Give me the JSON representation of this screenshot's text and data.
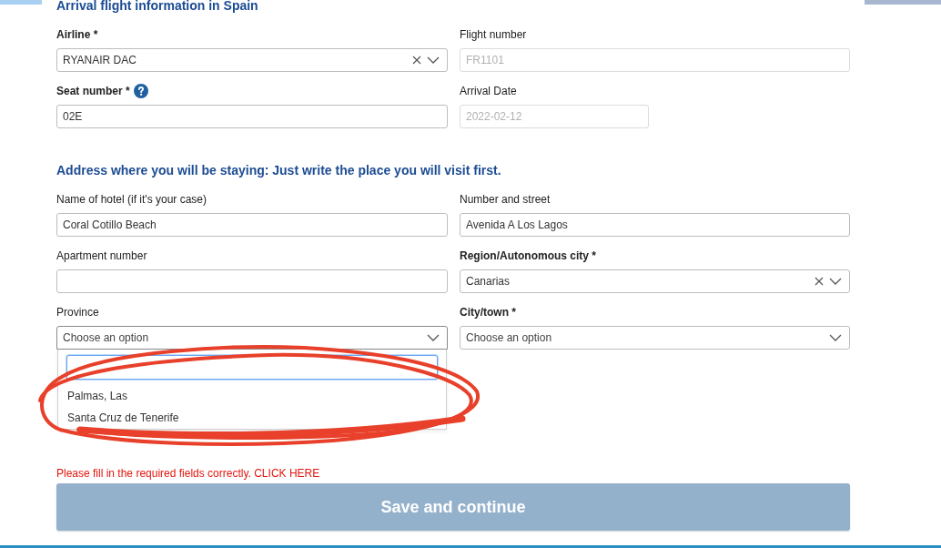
{
  "flight_section": {
    "title": "Arrival flight information in Spain",
    "fields": [
      {
        "kind": "select",
        "label": "Airline *",
        "required": true,
        "disabled": false,
        "value": "RYANAIR DAC",
        "clearable": true,
        "expanded": false
      },
      {
        "kind": "text",
        "label": "Flight number",
        "required": false,
        "disabled": true,
        "value": "FR1101"
      },
      {
        "kind": "text",
        "label": "Seat number *",
        "required": true,
        "disabled": false,
        "help": true,
        "value": "02E"
      },
      {
        "kind": "date",
        "label": "Arrival Date",
        "required": false,
        "disabled": true,
        "value": "2022-02-12"
      }
    ]
  },
  "address_section": {
    "title": "Address where you will be staying: Just write the place you will visit first.",
    "fields": [
      {
        "kind": "text",
        "label": "Name of hotel (if it's your case)",
        "required": false,
        "disabled": false,
        "value": "Coral Cotillo Beach"
      },
      {
        "kind": "text",
        "label": "Number and street",
        "required": false,
        "disabled": false,
        "value": "Avenida A Los Lagos"
      },
      {
        "kind": "text",
        "label": "Apartment number",
        "required": false,
        "disabled": false
      },
      {
        "kind": "select",
        "label": "Region/Autonomous city *",
        "required": true,
        "disabled": false,
        "value": "Canarias",
        "clearable": true,
        "expanded": false
      },
      {
        "kind": "select",
        "label": "Province",
        "required": false,
        "disabled": false,
        "placeholder": "Choose an option",
        "expanded": true,
        "options": [
          {
            "label": "Palmas, Las",
            "selected": false
          },
          {
            "label": "Santa Cruz de Tenerife",
            "selected": false
          }
        ]
      },
      {
        "kind": "select",
        "label": "City/town *",
        "required": true,
        "disabled": false,
        "placeholder": "Choose an option",
        "expanded": false
      }
    ]
  },
  "error_message": "Please fill in the required fields correctly. CLICK HERE",
  "save_button": {
    "label": "Save and continue",
    "disabled": true
  },
  "annotation": {
    "kind": "scribble"
  }
}
